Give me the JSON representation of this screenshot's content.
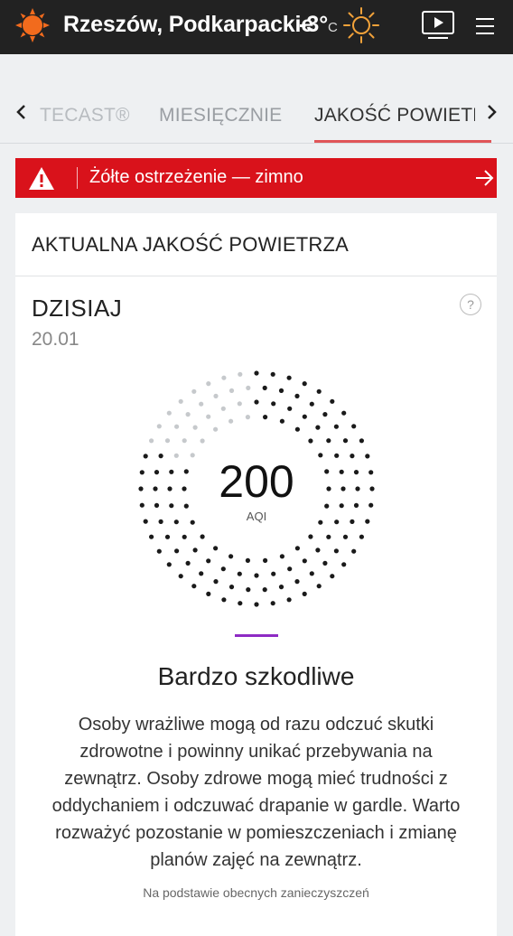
{
  "topbar": {
    "location": "Rzeszów, Podkarpackie",
    "temperature": "-3°",
    "unit": "C",
    "condition_icon": "sun-icon",
    "logo_icon": "sun-logo-icon",
    "accent": "#f26b1d"
  },
  "tabs": {
    "items": [
      {
        "label": "TECAST®",
        "active": false
      },
      {
        "label": "MIESIĘCZNIE",
        "active": false
      },
      {
        "label": "JAKOŚĆ POWIETRZA",
        "active": true
      }
    ],
    "underline_color": "#e05558"
  },
  "warning": {
    "text": "Żółte ostrzeżenie — zimno",
    "color": "#d9121b"
  },
  "card": {
    "title": "AKTUALNA JAKOŚĆ POWIETRZA",
    "day": "DZISIAJ",
    "date": "20.01",
    "help": "?",
    "aqi_value": "200",
    "aqi_unit": "AQI",
    "aqi_fraction": 0.8,
    "level_color": "#8e2bc4",
    "level_name": "Bardzo szkodliwe",
    "description": "Osoby wrażliwe mogą od razu odczuć skutki zdrowotne i powinny unikać przebywania na zewnątrz. Osoby zdrowe mogą mieć trudności z oddychaniem i odczuwać drapanie w gardle. Warto rozważyć pozostanie w pomieszczeniach i zmianę planów zajęć na zewnątrz.",
    "source_note": "Na podstawie obecnych zanieczyszczeń"
  }
}
